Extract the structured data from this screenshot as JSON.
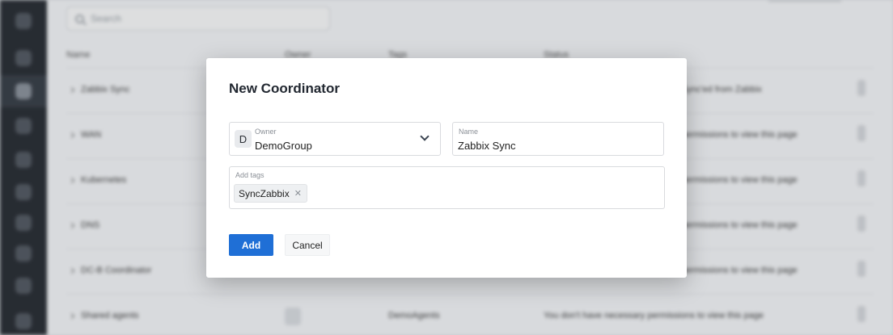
{
  "background": {
    "search_placeholder": "Search",
    "table_header": {
      "col_name": "Name",
      "col_2": "Owner",
      "col_3": "Tags",
      "col_4": "Status"
    },
    "rows": [
      {
        "name": "Zabbix Sync",
        "info": "Sync'ed from Zabbix"
      },
      {
        "name": "WAN",
        "info": "permissions to view this page"
      },
      {
        "name": "Kubernetes",
        "info": "permissions to view this page"
      },
      {
        "name": "DNS",
        "info": "permissions to view this page"
      },
      {
        "name": "DC-B Coordinator",
        "info": "permissions to view this page"
      },
      {
        "name": "Shared agents",
        "badge": "S",
        "owner": "DemoAgents",
        "info": "You don't have necessary permissions to view this page"
      }
    ]
  },
  "modal": {
    "title": "New Coordinator",
    "owner": {
      "label": "Owner",
      "value": "DemoGroup",
      "avatar_letter": "D",
      "icon": "chevron-down-icon"
    },
    "name": {
      "label": "Name",
      "value": "Zabbix Sync"
    },
    "tags": {
      "label": "Add tags",
      "items": [
        "SyncZabbix"
      ]
    },
    "buttons": {
      "add": "Add",
      "cancel": "Cancel"
    },
    "colors": {
      "primary": "#1f6fd6"
    }
  }
}
